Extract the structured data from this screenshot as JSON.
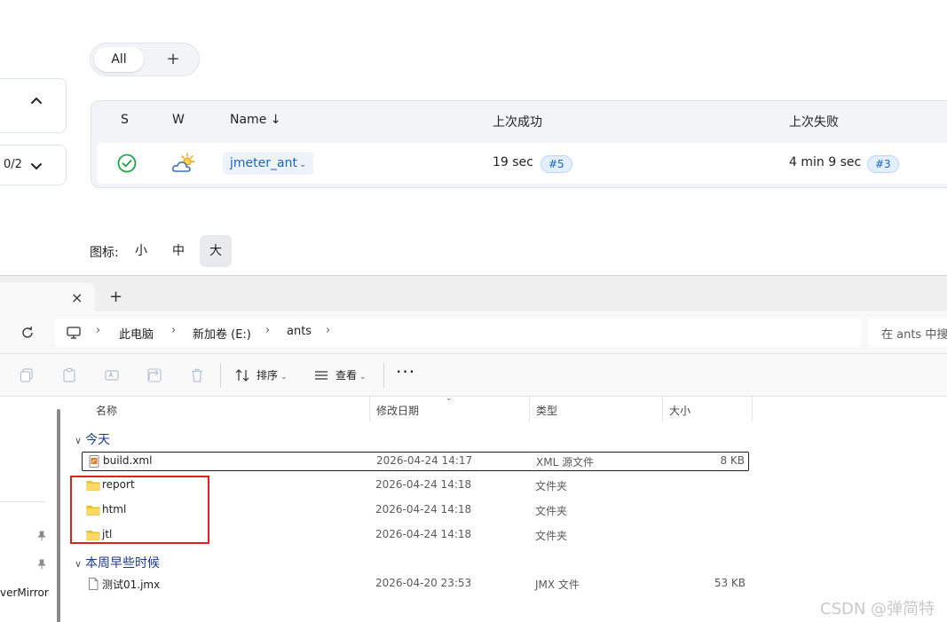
{
  "jenkins": {
    "view_tabs": {
      "all": "All",
      "add": "+"
    },
    "executors_count": "0/2",
    "table": {
      "headers": {
        "s": "S",
        "w": "W",
        "name": "Name ↓",
        "last_success": "上次成功",
        "last_failure": "上次失败"
      },
      "row": {
        "job_name": "jmeter_ant",
        "last_success_time": "19 sec",
        "last_success_build": "#5",
        "last_failure_time": "4 min 9 sec",
        "last_failure_build": "#3",
        "status": "success",
        "weather": "partly-cloudy"
      }
    },
    "icon_size": {
      "label": "图标:",
      "small": "小",
      "medium": "中",
      "large": "大",
      "selected": "大"
    }
  },
  "explorer": {
    "tab": {
      "close": "×",
      "new_tab": "+"
    },
    "breadcrumb": [
      "此电脑",
      "新加卷 (E:)",
      "ants"
    ],
    "search_placeholder": "在 ants 中搜索",
    "toolbar": {
      "sort": "排序",
      "view": "查看",
      "more": "···"
    },
    "nav": {
      "partial_item": "verMirror"
    },
    "columns": {
      "name": "名称",
      "date": "修改日期",
      "type": "类型",
      "size": "大小"
    },
    "groups": [
      {
        "label": "今天",
        "files": [
          {
            "name": "build.xml",
            "date": "2026-04-24 14:17",
            "type": "XML 源文件",
            "size": "8 KB",
            "icon": "xml-file-icon"
          },
          {
            "name": "report",
            "date": "2026-04-24 14:18",
            "type": "文件夹",
            "size": "",
            "icon": "folder-icon"
          },
          {
            "name": "html",
            "date": "2026-04-24 14:18",
            "type": "文件夹",
            "size": "",
            "icon": "folder-icon"
          },
          {
            "name": "jtl",
            "date": "2026-04-24 14:18",
            "type": "文件夹",
            "size": "",
            "icon": "folder-icon"
          }
        ]
      },
      {
        "label": "本周早些时候",
        "files": [
          {
            "name": "测试01.jmx",
            "date": "2026-04-20 23:53",
            "type": "JMX 文件",
            "size": "53 KB",
            "icon": "file-icon"
          }
        ]
      }
    ]
  },
  "watermark": "CSDN @弹简特",
  "colors": {
    "accent": "#1565c0",
    "success": "#1ea446",
    "highlight": "#e02020",
    "folder": "#f4c542"
  }
}
